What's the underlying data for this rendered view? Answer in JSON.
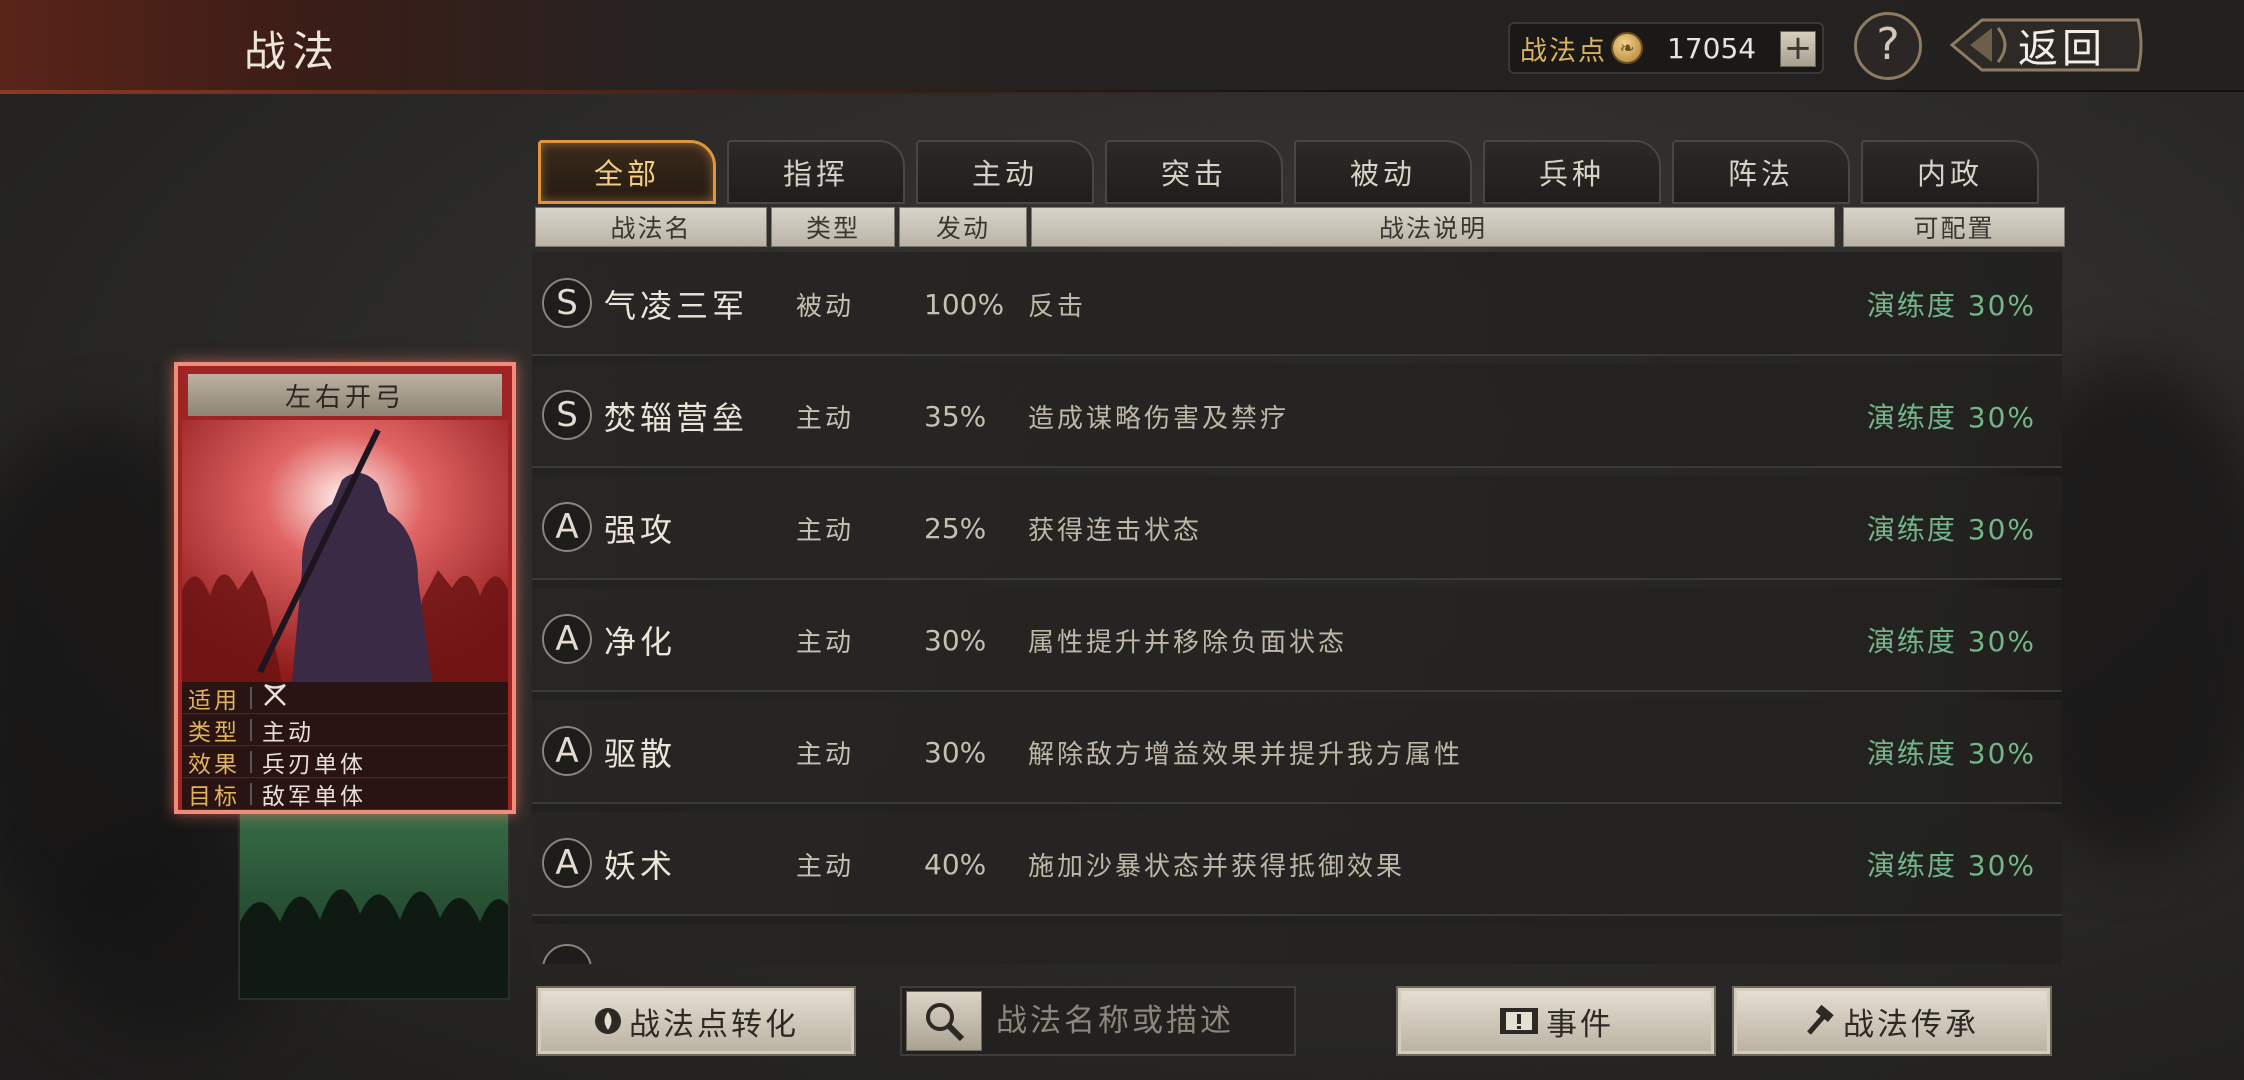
{
  "header": {
    "title": "战法",
    "points_label": "战法点",
    "points_value": "17054",
    "add_symbol": "+",
    "help_symbol": "?",
    "back_label": "返回"
  },
  "tabs": [
    {
      "label": "全部",
      "active": true
    },
    {
      "label": "指挥",
      "active": false
    },
    {
      "label": "主动",
      "active": false
    },
    {
      "label": "突击",
      "active": false
    },
    {
      "label": "被动",
      "active": false
    },
    {
      "label": "兵种",
      "active": false
    },
    {
      "label": "阵法",
      "active": false
    },
    {
      "label": "内政",
      "active": false
    }
  ],
  "columns": [
    "战法名",
    "类型",
    "发动",
    "战法说明",
    "可配置"
  ],
  "rows": [
    {
      "grade": "S",
      "name": "气凌三军",
      "type": "被动",
      "rate": "100%",
      "desc": "反击",
      "proficiency": "演练度 30%"
    },
    {
      "grade": "S",
      "name": "焚辎营垒",
      "type": "主动",
      "rate": "35%",
      "desc": "造成谋略伤害及禁疗",
      "proficiency": "演练度 30%"
    },
    {
      "grade": "A",
      "name": "强攻",
      "type": "主动",
      "rate": "25%",
      "desc": "获得连击状态",
      "proficiency": "演练度 30%"
    },
    {
      "grade": "A",
      "name": "净化",
      "type": "主动",
      "rate": "30%",
      "desc": "属性提升并移除负面状态",
      "proficiency": "演练度 30%"
    },
    {
      "grade": "A",
      "name": "驱散",
      "type": "主动",
      "rate": "30%",
      "desc": "解除敌方增益效果并提升我方属性",
      "proficiency": "演练度 30%"
    },
    {
      "grade": "A",
      "name": "妖术",
      "type": "主动",
      "rate": "40%",
      "desc": "施加沙暴状态并获得抵御效果",
      "proficiency": "演练度 30%"
    }
  ],
  "card": {
    "title": "左右开弓",
    "info": [
      {
        "key": "适用",
        "value": ""
      },
      {
        "key": "类型",
        "value": "主动"
      },
      {
        "key": "效果",
        "value": "兵刃单体"
      },
      {
        "key": "目标",
        "value": "敌军单体"
      }
    ]
  },
  "footer": {
    "convert_label": "战法点转化",
    "search_placeholder": "战法名称或描述",
    "event_label": "事件",
    "inherit_label": "战法传承"
  },
  "colors": {
    "accent_orange": "#e0953c",
    "proficiency_green": "#73b58a",
    "card_border": "#ef8c7a",
    "gold_text": "#d9b45c"
  }
}
